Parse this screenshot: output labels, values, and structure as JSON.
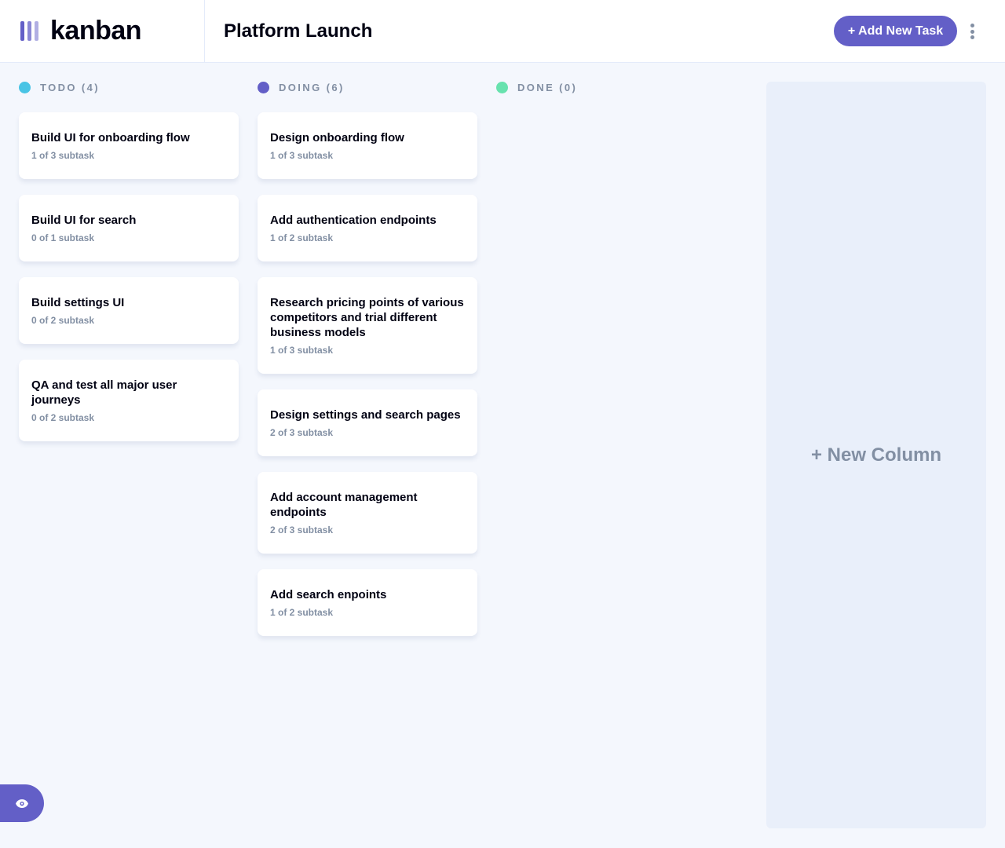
{
  "app": {
    "logo_text": "kanban"
  },
  "header": {
    "board_title": "Platform Launch",
    "add_task_label": "+ Add New Task"
  },
  "colors": {
    "accent": "#635FC7",
    "todo": "#49C4E5",
    "doing": "#635FC7",
    "done": "#67E2AE",
    "muted": "#828FA3",
    "background": "#F4F7FD"
  },
  "columns": [
    {
      "title": "TODO (4)",
      "dot_color": "#49C4E5",
      "tasks": [
        {
          "title": "Build UI for onboarding flow",
          "subtasks": "1 of 3 subtask"
        },
        {
          "title": "Build UI for search",
          "subtasks": "0 of 1 subtask"
        },
        {
          "title": "Build settings UI",
          "subtasks": "0 of 2 subtask"
        },
        {
          "title": "QA and test all major user journeys",
          "subtasks": "0 of 2 subtask"
        }
      ]
    },
    {
      "title": "DOING (6)",
      "dot_color": "#635FC7",
      "tasks": [
        {
          "title": "Design onboarding flow",
          "subtasks": "1 of 3 subtask"
        },
        {
          "title": "Add authentication endpoints",
          "subtasks": "1 of 2 subtask"
        },
        {
          "title": "Research pricing points of various competitors and trial different business models",
          "subtasks": "1 of 3 subtask"
        },
        {
          "title": "Design settings and search pages",
          "subtasks": "2 of 3 subtask"
        },
        {
          "title": "Add account management endpoints",
          "subtasks": "2 of 3 subtask"
        },
        {
          "title": "Add search enpoints",
          "subtasks": "1 of 2 subtask"
        }
      ]
    },
    {
      "title": "DONE (0)",
      "dot_color": "#67E2AE",
      "tasks": []
    }
  ],
  "new_column_label": "+ New Column",
  "icons": {
    "logo": "kanban-logo-icon",
    "menu": "vertical-ellipsis-icon",
    "show_sidebar": "eye-icon"
  }
}
